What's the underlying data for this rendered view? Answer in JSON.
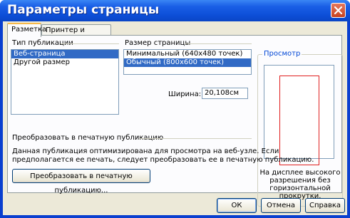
{
  "window": {
    "title": "Параметры страницы"
  },
  "tabs": [
    {
      "label": "Разметка",
      "active": true
    },
    {
      "label": "Принтер и бумага",
      "active": false
    }
  ],
  "publication_type": {
    "label": "Тип публикации",
    "items": [
      {
        "label": "Веб-страница",
        "selected": true
      },
      {
        "label": "Другой размер",
        "selected": false
      }
    ]
  },
  "page_size": {
    "label": "Размер страницы",
    "items": [
      {
        "label": "Минимальный (640x480 точек)",
        "selected": false
      },
      {
        "label": "Обычный (800x600 точек)",
        "selected": true
      }
    ],
    "width_label": "Ширина:",
    "width_value": "20,108см"
  },
  "preview": {
    "label": "Просмотр",
    "description": "На дисплее высокого разрешения без горизонтальной прокрутки."
  },
  "convert": {
    "label": "Преобразовать в печатную публикацию",
    "text_line1": "Данная публикация оптимизирована для просмотра на веб-узле. Если",
    "text_line2": "предполагается ее печать, следует преобразовать ее в печатную публикацию.",
    "button": "Преобразовать в печатную публикацию..."
  },
  "buttons": {
    "ok": "ОК",
    "cancel": "Отмена",
    "help": "Справка"
  },
  "colors": {
    "title_bar": "#0a4fd8",
    "selection": "#316ac5",
    "preview_frame": "#e02020",
    "dialog_bg": "#ece9d8"
  }
}
